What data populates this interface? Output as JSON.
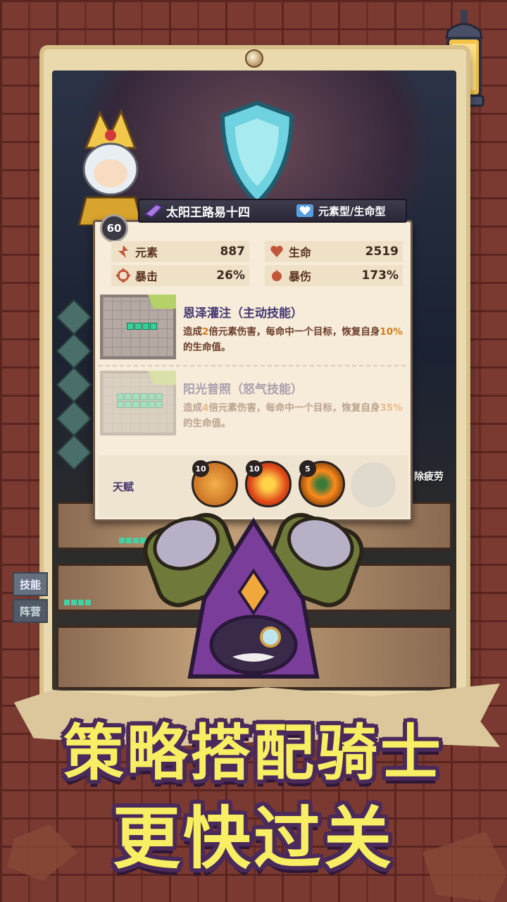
{
  "hero": {
    "level": "60",
    "name": "太阳王路易十四",
    "type": "元素型/生命型"
  },
  "stats": [
    {
      "icon": "element-icon",
      "label": "元素",
      "value": "887"
    },
    {
      "icon": "heart-icon",
      "label": "生命",
      "value": "2519"
    },
    {
      "icon": "crit-icon",
      "label": "暴击",
      "value": "26%"
    },
    {
      "icon": "crit-damage-icon",
      "label": "暴伤",
      "value": "173%"
    }
  ],
  "skills": [
    {
      "title": "恩泽灌注（主动技能）",
      "desc_pre": "造成",
      "desc_hl1": "2",
      "desc_mid": "倍元素伤害，每命中一个目标，恢复自身",
      "desc_hl2": "10%",
      "desc_post": "的生命值。"
    },
    {
      "title": "阳光普照（怒气技能）",
      "desc_pre": "造成",
      "desc_hl1": "4",
      "desc_mid": "倍元素伤害，每命中一个目标，恢复自身",
      "desc_hl2": "35%",
      "desc_post": "的生命值。"
    }
  ],
  "talents": {
    "label": "天赋",
    "items": [
      {
        "icon": "caduceus-talent-icon",
        "level": "10"
      },
      {
        "icon": "target-talent-icon",
        "level": "10"
      },
      {
        "icon": "flame-blade-talent-icon",
        "level": "5"
      }
    ]
  },
  "side_tabs": [
    "技能",
    "阵营"
  ],
  "rest_label": "除疲劳",
  "slogan": {
    "line1": "策略搭配骑士",
    "line2": "更快过关"
  },
  "colors": {
    "slogan_fill": "#f7ee63",
    "slogan_outline": "#4a2a5a",
    "skill_block": "#35d19a",
    "card_bg": "#f6ecd9"
  }
}
